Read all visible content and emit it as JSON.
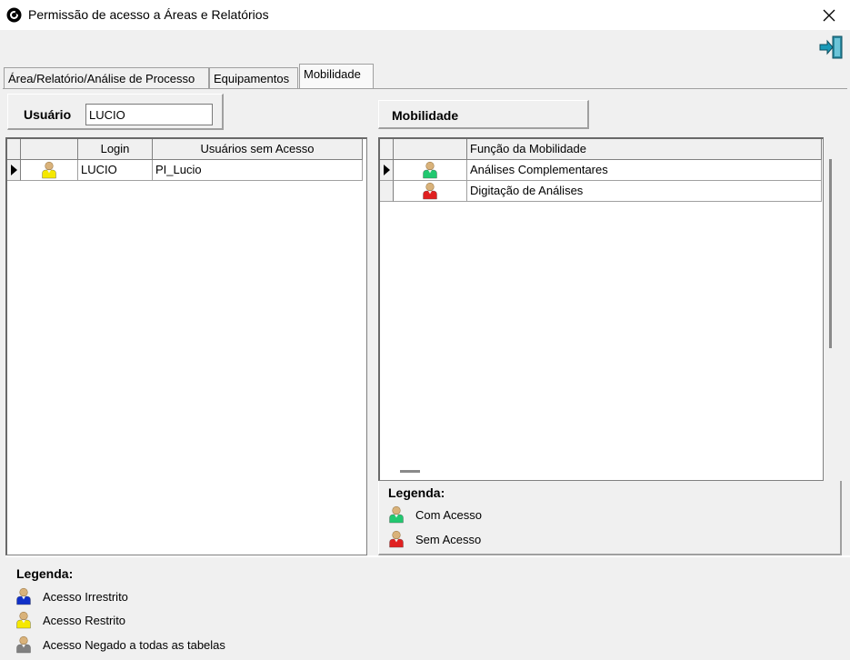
{
  "window": {
    "title": "Permissão de acesso a Áreas e Relatórios",
    "close_glyph": "✕"
  },
  "tabs": [
    {
      "label": "Área/Relatório/Análise de Processo",
      "active": false
    },
    {
      "label": "Equipamentos",
      "active": false
    },
    {
      "label": "Mobilidade",
      "active": true
    }
  ],
  "user": {
    "label": "Usuário",
    "value": "LUCIO"
  },
  "mobility_header": "Mobilidade",
  "users_grid": {
    "columns": [
      "",
      "Login",
      "Usuários sem Acesso"
    ],
    "rows": [
      {
        "icon": "user-yellow-icon",
        "login": "LUCIO",
        "users_without_access": "PI_Lucio",
        "selected": true
      }
    ]
  },
  "mobility_grid": {
    "columns": [
      "",
      "Função da Mobilidade"
    ],
    "rows": [
      {
        "icon": "user-green-icon",
        "function": "Análises Complementares",
        "selected": true
      },
      {
        "icon": "user-red-icon",
        "function": "Digitação de Análises",
        "selected": false
      }
    ]
  },
  "legend_mobility": {
    "title": "Legenda:",
    "items": [
      {
        "icon": "user-green-icon",
        "label": "Com Acesso"
      },
      {
        "icon": "user-red-icon",
        "label": "Sem Acesso"
      }
    ]
  },
  "legend_users": {
    "title": "Legenda:",
    "items": [
      {
        "icon": "user-blue-icon",
        "label": "Acesso Irrestrito"
      },
      {
        "icon": "user-yellow-icon",
        "label": "Acesso Restrito"
      },
      {
        "icon": "user-gray-icon",
        "label": "Acesso Negado a todas as tabelas"
      }
    ]
  },
  "colors": {
    "blue": "#1030c8",
    "yellow": "#f5e800",
    "gray": "#808080",
    "green": "#22c870",
    "red": "#e02020",
    "head": "#d9b27a"
  }
}
